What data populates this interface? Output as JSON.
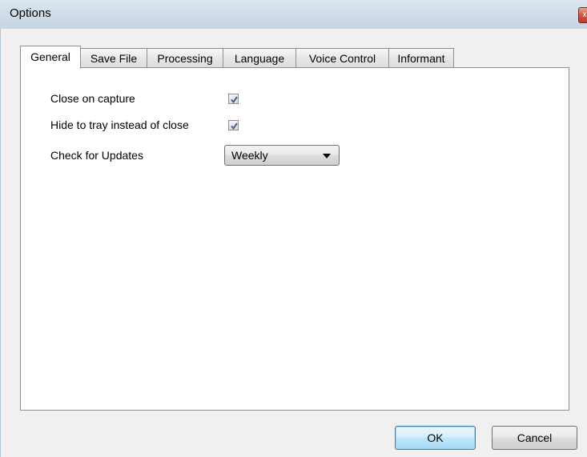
{
  "window": {
    "title": "Options",
    "close_glyph": "x"
  },
  "tabs": [
    {
      "label": "General",
      "active": true
    },
    {
      "label": "Save File",
      "active": false
    },
    {
      "label": "Processing",
      "active": false
    },
    {
      "label": "Language",
      "active": false
    },
    {
      "label": "Voice Control",
      "active": false
    },
    {
      "label": "Informant",
      "active": false
    }
  ],
  "general": {
    "close_on_capture": {
      "label": "Close on capture",
      "checked": true
    },
    "hide_to_tray": {
      "label": "Hide to tray instead of close",
      "checked": true
    },
    "check_updates": {
      "label": "Check for Updates",
      "value": "Weekly"
    }
  },
  "buttons": {
    "ok": "OK",
    "cancel": "Cancel"
  },
  "colors": {
    "check_mark": "#4a5f8a"
  },
  "icons": {
    "checkmark": "check-icon",
    "dropdown": "chevron-down-icon",
    "close": "close-icon"
  }
}
